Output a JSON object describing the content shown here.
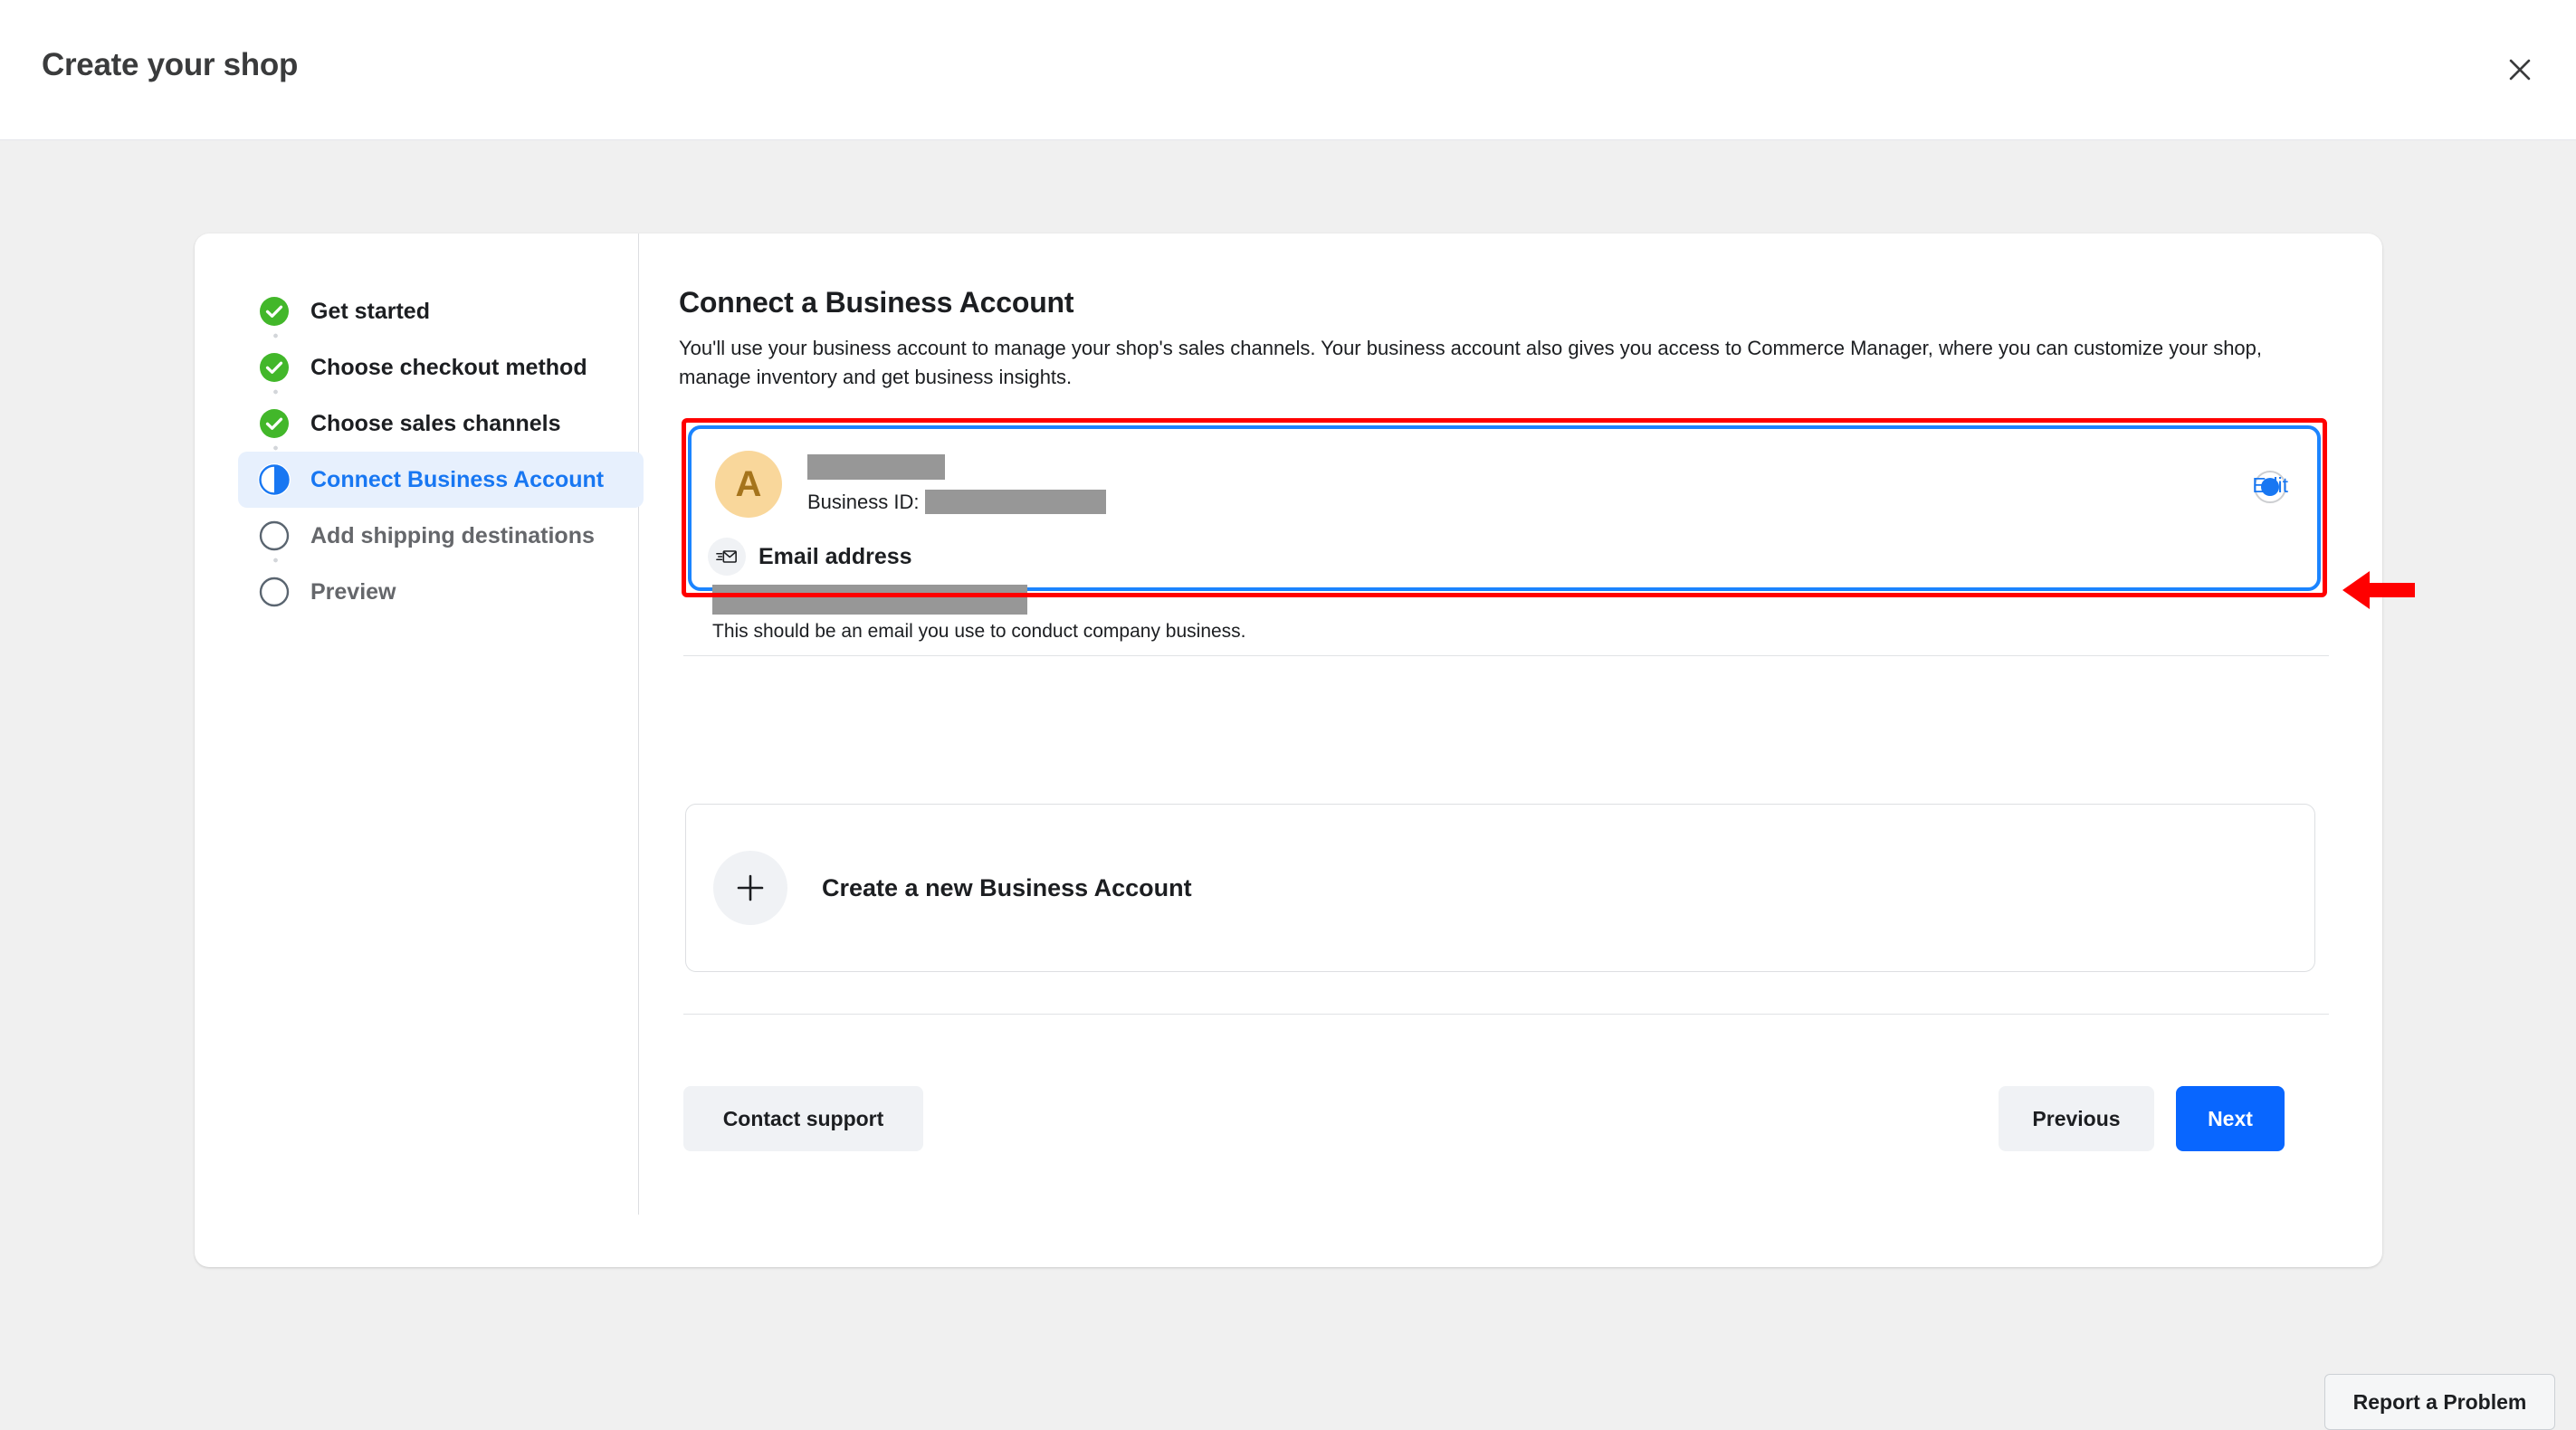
{
  "header": {
    "title": "Create your shop",
    "close_icon": "close-icon"
  },
  "stepper": {
    "items": [
      {
        "label": "Get started",
        "state": "done",
        "icon": "check-circle-icon"
      },
      {
        "label": "Choose checkout method",
        "state": "done",
        "icon": "check-circle-icon"
      },
      {
        "label": "Choose sales channels",
        "state": "done",
        "icon": "check-circle-icon"
      },
      {
        "label": "Connect Business Account",
        "state": "active",
        "icon": "half-circle-icon"
      },
      {
        "label": "Add shipping destinations",
        "state": "todo",
        "icon": "empty-circle-icon"
      },
      {
        "label": "Preview",
        "state": "todo",
        "icon": "empty-circle-icon"
      }
    ]
  },
  "main": {
    "title": "Connect a Business Account",
    "description": "You'll use your business account to manage your shop's sales channels. Your business account also gives you access to Commerce Manager, where you can customize your shop, manage inventory and get business insights."
  },
  "account_card": {
    "avatar_initial": "A",
    "business_name_redacted": true,
    "business_id_label": "Business ID:",
    "business_id_redacted": true,
    "selected": true,
    "email": {
      "icon": "envelope-send-icon",
      "title": "Email address",
      "value_redacted": true,
      "help_text": "This should be an email you use to conduct company business.",
      "edit_label": "Edit"
    }
  },
  "create_account_card": {
    "icon": "plus-icon",
    "label": "Create a new Business Account"
  },
  "footer": {
    "contact_support_label": "Contact support",
    "previous_label": "Previous",
    "next_label": "Next"
  },
  "report": {
    "label": "Report a Problem"
  },
  "annotation": {
    "type": "arrow-left",
    "color": "#ff0000",
    "highlight_color": "#ff0000"
  },
  "colors": {
    "accent_blue": "#1877f2",
    "primary_button": "#0866ff",
    "done_green": "#42b72a",
    "active_step_bg": "#e7f0fd",
    "avatar_bg": "#f9d79b",
    "avatar_fg": "#a5741c",
    "redaction": "#979797"
  }
}
